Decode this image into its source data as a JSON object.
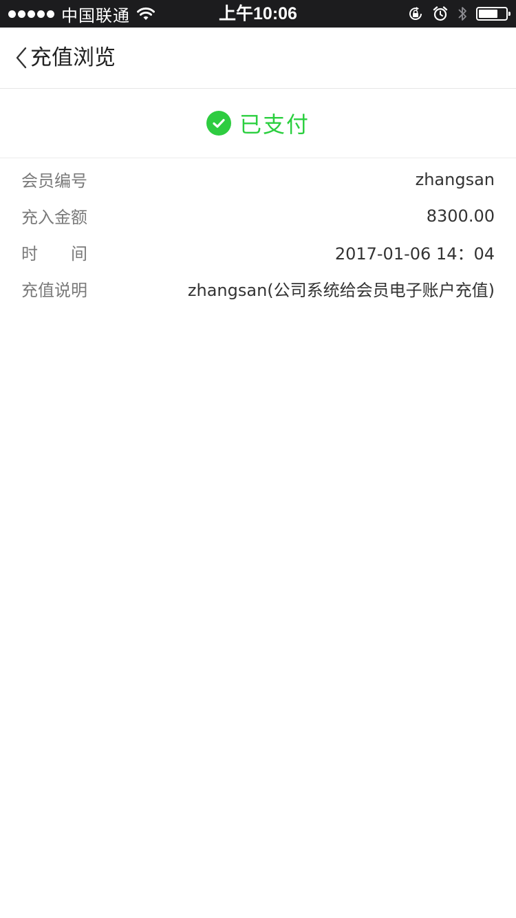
{
  "status_bar": {
    "carrier": "中国联通",
    "time": "上午10:06",
    "battery_level": 0.72
  },
  "nav": {
    "title": "充值浏览"
  },
  "status": {
    "text": "已支付",
    "color": "#2bcf3f"
  },
  "details": [
    {
      "label": "会员编号",
      "value": "zhangsan"
    },
    {
      "label": "充入金额",
      "value": "8300.00"
    },
    {
      "label": "时间",
      "value": "2017-01-06 14：04"
    },
    {
      "label": "充值说明",
      "value": "zhangsan(公司系统给会员电子账户充值)"
    }
  ]
}
